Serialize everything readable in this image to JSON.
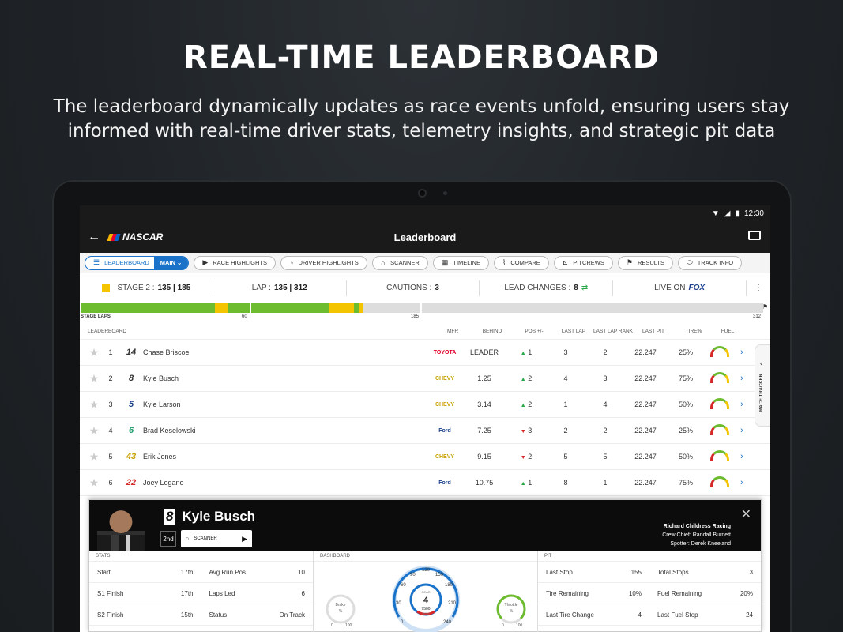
{
  "hero": {
    "title": "REAL-TIME LEADERBOARD",
    "subtitle": "The leaderboard dynamically updates as race events unfold, ensuring users stay informed with real-time driver stats, telemetry insights, and strategic pit data"
  },
  "statusbar": {
    "time": "12:30"
  },
  "appbar": {
    "logo": "NASCAR",
    "title": "Leaderboard"
  },
  "tabs": [
    {
      "label": "LEADERBOARD",
      "icon": "list-icon"
    },
    {
      "label": "RACE HIGHLIGHTS",
      "icon": "play-icon"
    },
    {
      "label": "DRIVER HIGHLIGHTS",
      "icon": "helmet-icon"
    },
    {
      "label": "SCANNER",
      "icon": "headphones-icon"
    },
    {
      "label": "TIMELINE",
      "icon": "timeline-icon"
    },
    {
      "label": "COMPARE",
      "icon": "compare-icon"
    },
    {
      "label": "PITCREWS",
      "icon": "pitcrew-icon"
    },
    {
      "label": "RESULTS",
      "icon": "flag-icon"
    },
    {
      "label": "TRACK INFO",
      "icon": "track-icon"
    }
  ],
  "tab_main": "MAIN",
  "race": {
    "stage_label": "STAGE 2 :",
    "stage_value": "135 | 185",
    "lap_label": "LAP :",
    "lap_value": "135 | 312",
    "cautions_label": "CAUTIONS :",
    "cautions_value": "3",
    "lead_label": "LEAD CHANGES :",
    "lead_value": "8",
    "live_label": "LIVE ON",
    "network": "FOX"
  },
  "progress": {
    "stage_laps": "STAGE LAPS",
    "m1": "60",
    "m2": "185",
    "m3": "312"
  },
  "columns": {
    "leaderboard": "LEADERBOARD",
    "mfr": "MFR",
    "behind": "BEHIND",
    "pos": "POS +/-",
    "last_lap": "LAST LAP",
    "last_lap_rank": "LAST LAP RANK",
    "last_pit": "LAST PIT",
    "tire": "TIRE%",
    "fuel": "FUEL"
  },
  "rows": [
    {
      "pos": "1",
      "num": "14",
      "name": "Chase Briscoe",
      "mfr": "TOYOTA",
      "behind": "LEADER",
      "dir": "▲",
      "delta": "1",
      "last": "3",
      "rank": "2",
      "pit": "22.247",
      "tire": "25%"
    },
    {
      "pos": "2",
      "num": "8",
      "name": "Kyle Busch",
      "mfr": "CHEVY",
      "behind": "1.25",
      "dir": "▲",
      "delta": "2",
      "last": "4",
      "rank": "3",
      "pit": "22.247",
      "tire": "75%"
    },
    {
      "pos": "3",
      "num": "5",
      "name": "Kyle Larson",
      "mfr": "CHEVY",
      "behind": "3.14",
      "dir": "▲",
      "delta": "2",
      "last": "1",
      "rank": "4",
      "pit": "22.247",
      "tire": "50%"
    },
    {
      "pos": "4",
      "num": "6",
      "name": "Brad Keselowski",
      "mfr": "Ford",
      "behind": "7.25",
      "dir": "▼",
      "delta": "3",
      "last": "2",
      "rank": "2",
      "pit": "22.247",
      "tire": "25%"
    },
    {
      "pos": "5",
      "num": "43",
      "name": "Erik Jones",
      "mfr": "CHEVY",
      "behind": "9.15",
      "dir": "▼",
      "delta": "2",
      "last": "5",
      "rank": "5",
      "pit": "22.247",
      "tire": "50%"
    },
    {
      "pos": "6",
      "num": "22",
      "name": "Joey Logano",
      "mfr": "Ford",
      "behind": "10.75",
      "dir": "▲",
      "delta": "1",
      "last": "8",
      "rank": "1",
      "pit": "22.247",
      "tire": "75%"
    }
  ],
  "tracker": {
    "label": "RACE TRACKER"
  },
  "card": {
    "num": "8",
    "name": "Kyle Busch",
    "position": "2nd",
    "scanner": "SCANNER",
    "team": "Richard Childress Racing",
    "crew_chief": "Crew Chief: Randall Burnett",
    "spotter": "Spotter: Derek Kneeland",
    "stats_head": "STATS",
    "dash_head": "DASHBOARD",
    "pit_head": "PIT",
    "stats": [
      {
        "k": "Start",
        "v": "17th"
      },
      {
        "k": "Avg Run Pos",
        "v": "10"
      },
      {
        "k": "S1 Finish",
        "v": "17th"
      },
      {
        "k": "Laps Led",
        "v": "6"
      },
      {
        "k": "S2 Finish",
        "v": "15th"
      },
      {
        "k": "Status",
        "v": "On Track"
      }
    ],
    "pit": [
      {
        "k": "Last Stop",
        "v": "155"
      },
      {
        "k": "Total Stops",
        "v": "3"
      },
      {
        "k": "Tire Remaining",
        "v": "10%"
      },
      {
        "k": "Fuel Remaining",
        "v": "20%"
      },
      {
        "k": "Last Tire Change",
        "v": "4"
      },
      {
        "k": "Last Fuel Stop",
        "v": "24"
      }
    ],
    "dash": {
      "brake": "Brake",
      "throttle": "Throttle",
      "unit": "%",
      "g0": "0",
      "g100": "100",
      "ticks": [
        "0",
        "30",
        "60",
        "90",
        "120",
        "150",
        "180",
        "210",
        "240"
      ],
      "gear_label": "GEAR",
      "gear": "4",
      "rpm": "7500",
      "rpm_unit": "RPM"
    }
  },
  "colors": {
    "accent": "#1a73c9",
    "green": "#6dbb2f",
    "yellow": "#f5c400"
  }
}
